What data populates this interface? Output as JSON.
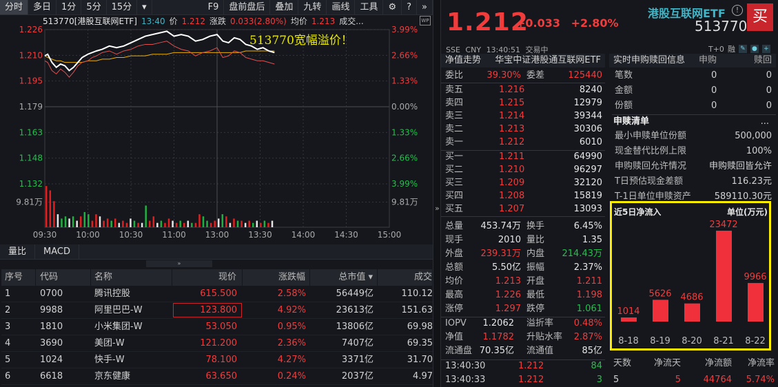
{
  "toolbar": {
    "left": [
      "分时",
      "多日",
      "1分",
      "5分",
      "15分",
      "▾"
    ],
    "right": [
      "F9",
      "盘前盘后",
      "叠加",
      "九转",
      "画线",
      "工具"
    ],
    "active": "分时"
  },
  "chart_header": {
    "name": "513770[港股互联网ETF]",
    "time": "13:40",
    "price_label": "价",
    "price": "1.212",
    "chg_label": "涨跌",
    "chg": "0.033(2.80%)",
    "avg_label": "均价",
    "avg": "1.213",
    "vol_label": "成交..."
  },
  "wp_label": "WP",
  "chart_data": {
    "type": "line",
    "title": "513770宽幅溢价！",
    "y_left_ticks": [
      "1.226",
      "1.210",
      "1.195",
      "1.179",
      "1.163",
      "1.148",
      "1.132"
    ],
    "y_right_ticks": [
      "3.99%",
      "2.66%",
      "1.33%",
      "0.00%",
      "1.33%",
      "2.66%",
      "3.99%"
    ],
    "ylim": [
      1.132,
      1.226
    ],
    "prev_close": 1.179,
    "x_ticks": [
      "09:30",
      "10:00",
      "10:30",
      "11:00",
      "13:00",
      "13:30",
      "14:00",
      "14:30",
      "15:00"
    ],
    "volume_label": "9.81万",
    "minutes": [
      0,
      2,
      5,
      8,
      11,
      14,
      17,
      20,
      23,
      26,
      30,
      33,
      36,
      40,
      45,
      50,
      55,
      60,
      65,
      70,
      75,
      80,
      85,
      90,
      95,
      100,
      105,
      110,
      115,
      120,
      124,
      128,
      132,
      136,
      140,
      144,
      148,
      152,
      156,
      160
    ],
    "series": [
      {
        "name": "价格",
        "color": "#ffffff",
        "values": [
          1.21,
          1.211,
          1.206,
          1.203,
          1.205,
          1.204,
          1.201,
          1.203,
          1.206,
          1.209,
          1.211,
          1.212,
          1.213,
          1.214,
          1.216,
          1.215,
          1.216,
          1.218,
          1.22,
          1.222,
          1.223,
          1.224,
          1.225,
          1.222,
          1.223,
          1.222,
          1.219,
          1.22,
          1.222,
          1.223,
          1.219,
          1.218,
          1.221,
          1.22,
          1.217,
          1.216,
          1.214,
          1.215,
          1.213,
          1.212
        ]
      },
      {
        "name": "净值",
        "color": "#e05050",
        "values": [
          1.207,
          1.206,
          1.201,
          1.199,
          1.202,
          1.2,
          1.197,
          1.2,
          1.204,
          1.206,
          1.207,
          1.209,
          1.21,
          1.212,
          1.213,
          1.211,
          1.213,
          1.214,
          1.216,
          1.217,
          1.217,
          1.218,
          1.219,
          1.216,
          1.214,
          1.213,
          1.21,
          1.212,
          1.213,
          1.215,
          1.209,
          1.21,
          1.213,
          1.212,
          1.209,
          1.208,
          1.207,
          1.207,
          1.206,
          1.205
        ]
      },
      {
        "name": "均价",
        "color": "#f0b000",
        "values": [
          1.21,
          1.209,
          1.208,
          1.207,
          1.207,
          1.206,
          1.206,
          1.206,
          1.206,
          1.206,
          1.207,
          1.207,
          1.207,
          1.208,
          1.208,
          1.209,
          1.209,
          1.21,
          1.21,
          1.21,
          1.211,
          1.211,
          1.211,
          1.212,
          1.212,
          1.212,
          1.212,
          1.212,
          1.212,
          1.212,
          1.212,
          1.212,
          1.212,
          1.212,
          1.213,
          1.213,
          1.213,
          1.213,
          1.213,
          1.213
        ]
      }
    ],
    "volume": [
      [
        19,
        1
      ],
      [
        17,
        1
      ],
      [
        12,
        1
      ],
      [
        6,
        0
      ],
      [
        4,
        -1
      ],
      [
        5,
        -1
      ],
      [
        4,
        0
      ],
      [
        5,
        -1
      ],
      [
        3,
        0
      ],
      [
        5,
        1
      ],
      [
        7,
        -1
      ],
      [
        6,
        -1
      ],
      [
        3,
        1
      ],
      [
        6,
        1
      ],
      [
        5,
        0
      ],
      [
        3,
        1
      ],
      [
        4,
        1
      ],
      [
        3,
        -1
      ],
      [
        4,
        1
      ],
      [
        2,
        0
      ],
      [
        3,
        1
      ],
      [
        2,
        1
      ],
      [
        4,
        0
      ],
      [
        3,
        -1
      ],
      [
        2,
        1
      ],
      [
        2,
        0
      ],
      [
        10,
        -1
      ],
      [
        3,
        1
      ],
      [
        5,
        1
      ],
      [
        2,
        0
      ],
      [
        3,
        -1
      ],
      [
        2,
        1
      ],
      [
        4,
        1
      ],
      [
        3,
        0
      ],
      [
        2,
        1
      ],
      [
        3,
        -1
      ],
      [
        2,
        1
      ],
      [
        3,
        0
      ],
      [
        2,
        -1
      ],
      [
        2,
        1
      ],
      [
        6,
        1
      ],
      [
        5,
        -1
      ],
      [
        3,
        -1
      ],
      [
        2,
        1
      ],
      [
        3,
        1
      ],
      [
        4,
        0
      ],
      [
        6,
        -1
      ],
      [
        5,
        1
      ],
      [
        2,
        0
      ],
      [
        4,
        1
      ],
      [
        3,
        -1
      ],
      [
        3,
        1
      ],
      [
        2,
        0
      ],
      [
        3,
        1
      ],
      [
        2,
        -1
      ],
      [
        3,
        0
      ],
      [
        2,
        1
      ],
      [
        3,
        -1
      ],
      [
        2,
        1
      ],
      [
        3,
        0
      ]
    ]
  },
  "subtabs": [
    "量比",
    "MACD"
  ],
  "table": {
    "headers": [
      "序号",
      "代码",
      "名称",
      "现价",
      "涨跌幅",
      "总市值 ▾",
      "成交"
    ],
    "rows": [
      [
        "1",
        "0700",
        "腾讯控股",
        "615.500",
        "2.58%",
        "56449亿",
        "110.12"
      ],
      [
        "2",
        "9988",
        "阿里巴巴-W",
        "123.800",
        "4.92%",
        "23613亿",
        "151.63"
      ],
      [
        "3",
        "1810",
        "小米集团-W",
        "53.050",
        "0.95%",
        "13806亿",
        "69.98"
      ],
      [
        "4",
        "3690",
        "美团-W",
        "121.200",
        "2.36%",
        "7407亿",
        "69.35"
      ],
      [
        "5",
        "1024",
        "快手-W",
        "78.100",
        "4.27%",
        "3371亿",
        "31.70"
      ],
      [
        "6",
        "6618",
        "京东健康",
        "63.650",
        "0.24%",
        "2037亿",
        "4.97"
      ]
    ]
  },
  "quote": {
    "price": "1.212",
    "change": "+0.033",
    "pct": "+2.80%",
    "name": "港股互联网ETF",
    "code": "513770",
    "buy": "买",
    "exchange": "SSE",
    "currency": "CNY",
    "time": "13:40:51",
    "status": "交易中",
    "t0": "T+0",
    "margin": "融"
  },
  "nav_header": {
    "left": "净值走势",
    "right": "华宝中证港股通互联网ETF"
  },
  "weibi": {
    "l1": "委比",
    "v1": "39.30%",
    "l2": "委差",
    "v2": "125440"
  },
  "asks": [
    [
      "卖五",
      "1.216",
      "8240"
    ],
    [
      "卖四",
      "1.215",
      "12979"
    ],
    [
      "卖三",
      "1.214",
      "39344"
    ],
    [
      "卖二",
      "1.213",
      "30306"
    ],
    [
      "卖一",
      "1.212",
      "6010"
    ]
  ],
  "bids": [
    [
      "买一",
      "1.211",
      "64990"
    ],
    [
      "买二",
      "1.210",
      "96297"
    ],
    [
      "买三",
      "1.209",
      "32120"
    ],
    [
      "买四",
      "1.208",
      "15819"
    ],
    [
      "买五",
      "1.207",
      "13093"
    ]
  ],
  "stats": [
    [
      "总量",
      "453.74万",
      "w",
      "换手",
      "6.45%",
      "w"
    ],
    [
      "现手",
      "2010",
      "w",
      "量比",
      "1.35",
      "w"
    ],
    [
      "外盘",
      "239.31万",
      "r",
      "内盘",
      "214.43万",
      "g"
    ],
    [
      "总额",
      "5.50亿",
      "w",
      "振幅",
      "2.37%",
      "w"
    ],
    [
      "均价",
      "1.213",
      "r",
      "开盘",
      "1.211",
      "r"
    ],
    [
      "最高",
      "1.226",
      "r",
      "最低",
      "1.198",
      "r"
    ],
    [
      "涨停",
      "1.297",
      "r",
      "跌停",
      "1.061",
      "g"
    ]
  ],
  "iopv": [
    [
      "IOPV",
      "1.2062",
      "w",
      "溢折率",
      "0.48%",
      "r"
    ],
    [
      "净值",
      "1.1782",
      "r",
      "升贴水率",
      "2.87%",
      "r"
    ],
    [
      "流通盘",
      "70.35亿",
      "w",
      "流通值",
      "85亿",
      "w"
    ]
  ],
  "ticks": [
    [
      "13:40:30",
      "1.212",
      "84"
    ],
    [
      "13:40:33",
      "1.212",
      "3"
    ]
  ],
  "realtime": {
    "title": "实时申购赎回信息",
    "col1": "申购",
    "col2": "赎回",
    "rows": [
      [
        "笔数",
        "0",
        "0"
      ],
      [
        "金额",
        "0",
        "0"
      ],
      [
        "份额",
        "0",
        "0"
      ]
    ]
  },
  "list": {
    "title": "申赎清单",
    "more": "...",
    "rows": [
      [
        "最小申赎单位份额",
        "500,000"
      ],
      [
        "现金替代比例上限",
        "100%"
      ],
      [
        "申购赎回允许情况",
        "申购赎回皆允许"
      ],
      [
        "T日预估现金差额",
        "116.23元"
      ],
      [
        "T-1日单位申赎资产",
        "589110.30元"
      ]
    ]
  },
  "flow_chart": {
    "title": "近5日净流入",
    "unit": "单位(万元)",
    "type": "bar",
    "categories": [
      "8-18",
      "8-19",
      "8-20",
      "8-21",
      "8-22"
    ],
    "values": [
      1014,
      5626,
      4686,
      23472,
      9966
    ],
    "color": "#f0303a"
  },
  "flow_summary": {
    "headers": [
      "天数",
      "净流天",
      "净流额",
      "净流率"
    ],
    "values": [
      "5",
      "5",
      "44764",
      "5.74%"
    ]
  }
}
